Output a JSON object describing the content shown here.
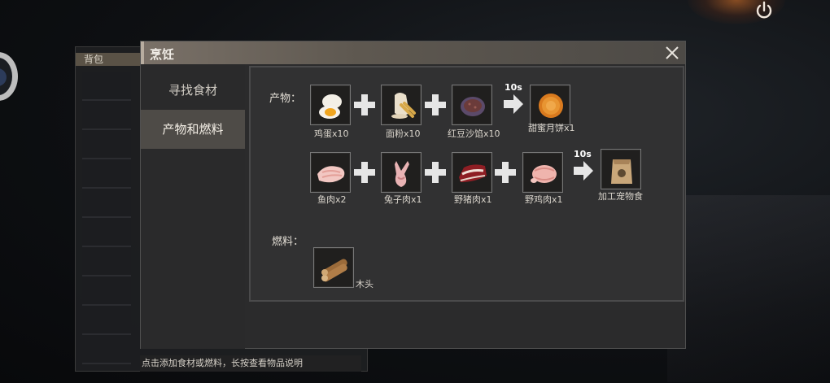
{
  "backpack": {
    "title": "背包"
  },
  "dialog": {
    "title": "烹饪",
    "tabs": [
      {
        "label": "寻找食材",
        "active": false
      },
      {
        "label": "产物和燃料",
        "active": true
      }
    ]
  },
  "products_label": "产物：",
  "fuel_label": "燃料：",
  "recipes": [
    {
      "ingredients": [
        {
          "name": "鸡蛋x10",
          "icon": "egg-icon"
        },
        {
          "name": "面粉x10",
          "icon": "flour-icon"
        },
        {
          "name": "红豆沙馅x10",
          "icon": "red-bean-paste-icon"
        }
      ],
      "time": "10s",
      "result": {
        "name": "甜蜜月饼x1",
        "icon": "mooncake-icon"
      }
    },
    {
      "ingredients": [
        {
          "name": "鱼肉x2",
          "icon": "fish-meat-icon"
        },
        {
          "name": "兔子肉x1",
          "icon": "rabbit-meat-icon"
        },
        {
          "name": "野猪肉x1",
          "icon": "boar-meat-icon"
        },
        {
          "name": "野鸡肉x1",
          "icon": "pheasant-meat-icon"
        }
      ],
      "time": "10s",
      "result": {
        "name": "加工宠物食",
        "icon": "pet-food-bag-icon"
      }
    }
  ],
  "fuel": {
    "name": "木头",
    "icon": "wood-logs-icon"
  },
  "hint": "点击添加食材或燃料，长按查看物品说明",
  "colors": {
    "accent": "#7a7168",
    "active_tab": "#4e4b47",
    "panel": "#2b2b2c"
  }
}
